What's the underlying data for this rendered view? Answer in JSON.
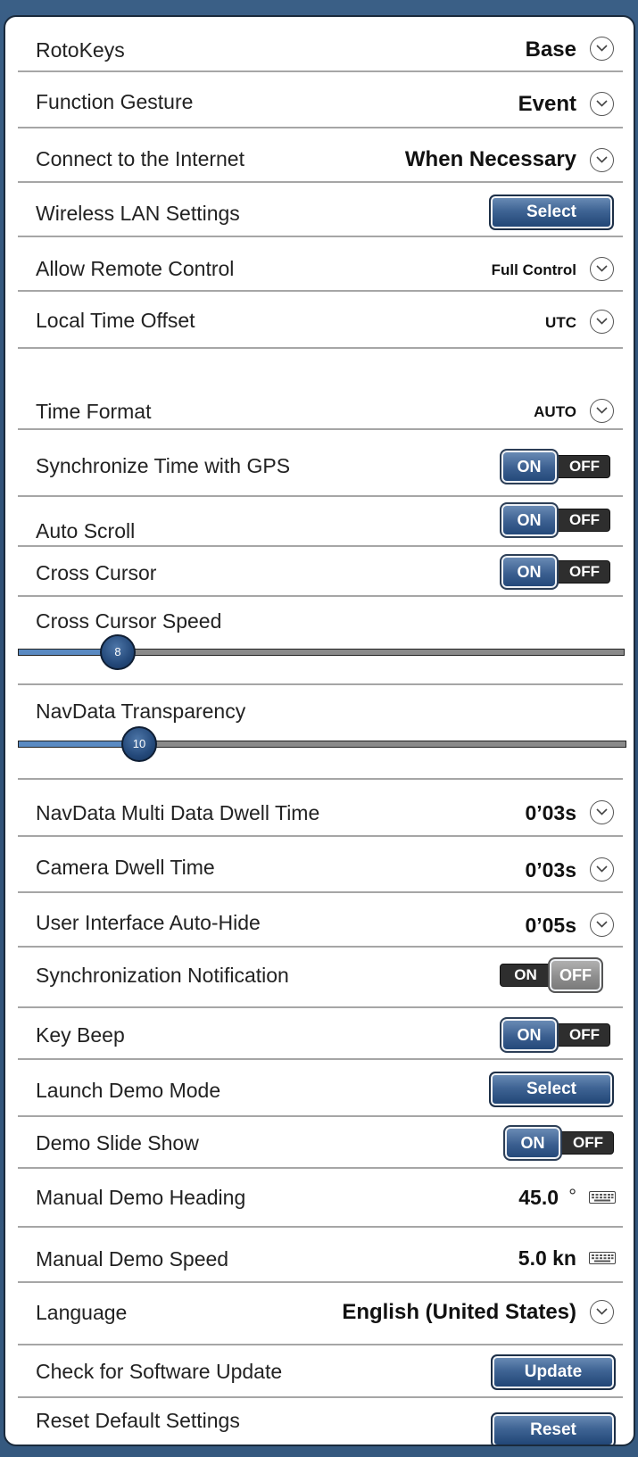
{
  "settings": {
    "rotokeys": {
      "label": "RotoKeys",
      "value": "Base"
    },
    "function_gesture": {
      "label": "Function Gesture",
      "value": "Event"
    },
    "connect_internet": {
      "label": "Connect to the Internet",
      "value": "When Necessary"
    },
    "wireless_lan": {
      "label": "Wireless LAN Settings",
      "button": "Select"
    },
    "remote_control": {
      "label": "Allow Remote Control",
      "value": "Full Control"
    },
    "time_offset": {
      "label": "Local Time Offset",
      "value": "UTC"
    },
    "time_format": {
      "label": "Time Format",
      "value": "AUTO"
    },
    "sync_time_gps": {
      "label": "Synchronize Time with GPS",
      "on": "ON",
      "off": "OFF",
      "state": "ON"
    },
    "auto_scroll": {
      "label": "Auto Scroll",
      "on": "ON",
      "off": "OFF",
      "state": "ON"
    },
    "cross_cursor": {
      "label": "Cross Cursor",
      "on": "ON",
      "off": "OFF",
      "state": "ON"
    },
    "cross_cursor_speed": {
      "label": "Cross Cursor Speed",
      "value": "8"
    },
    "navdata_transparency": {
      "label": "NavData Transparency",
      "value": "10"
    },
    "navdata_dwell": {
      "label": "NavData Multi Data Dwell Time",
      "value": "0’03s"
    },
    "camera_dwell": {
      "label": "Camera Dwell Time",
      "value": "0’03s"
    },
    "ui_autohide": {
      "label": "User Interface Auto-Hide",
      "value": "0’05s"
    },
    "sync_notification": {
      "label": "Synchronization Notification",
      "on": "ON",
      "off": "OFF",
      "state": "OFF"
    },
    "key_beep": {
      "label": "Key Beep",
      "on": "ON",
      "off": "OFF",
      "state": "ON"
    },
    "launch_demo": {
      "label": "Launch Demo Mode",
      "button": "Select"
    },
    "demo_slideshow": {
      "label": "Demo Slide Show",
      "on": "ON",
      "off": "OFF",
      "state": "ON"
    },
    "manual_heading": {
      "label": "Manual Demo Heading",
      "value": "45.0",
      "unit": "°"
    },
    "manual_speed": {
      "label": "Manual Demo Speed",
      "value": "5.0 kn"
    },
    "language": {
      "label": "Language",
      "value": "English (United States)"
    },
    "software_update": {
      "label": "Check for Software Update",
      "button": "Update"
    },
    "reset_defaults": {
      "label": "Reset Default Settings",
      "button": "Reset"
    }
  },
  "colors": {
    "button_blue": "#3f6494",
    "slider_fill": "#5a8ac2",
    "background": "#2f5076"
  },
  "icons": {
    "dropdown": "chevron-down-icon",
    "keyboard": "keyboard-icon"
  }
}
